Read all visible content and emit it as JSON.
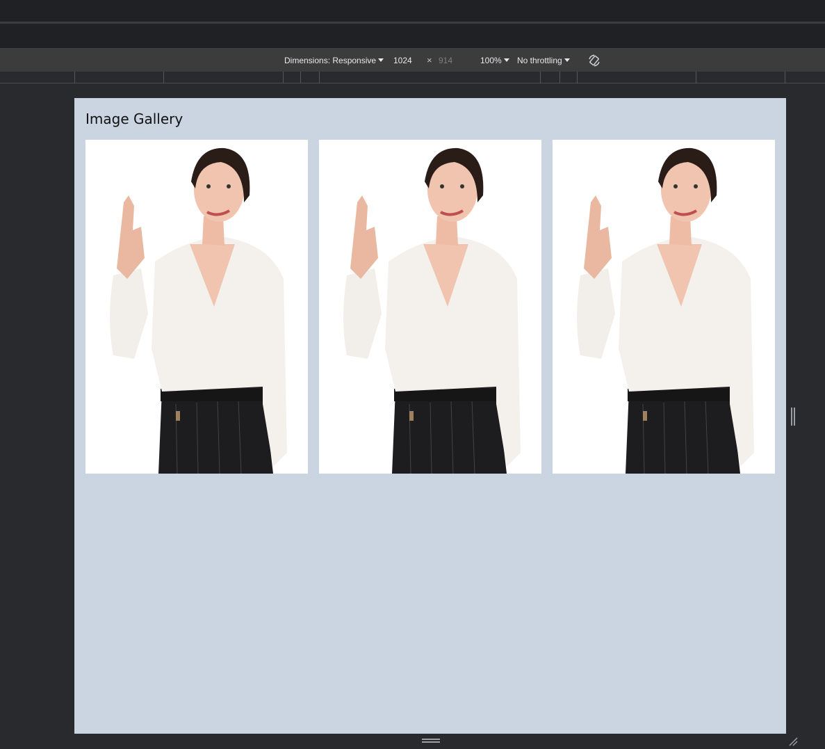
{
  "device_toolbar": {
    "dimensions_label": "Dimensions: Responsive",
    "width_value": "1024",
    "times_symbol": "×",
    "height_value": "914",
    "zoom_label": "100%",
    "throttling_label": "No throttling"
  },
  "page": {
    "title": "Image Gallery",
    "images": [
      {
        "alt": "Woman in white blouse pointing up"
      },
      {
        "alt": "Woman in white blouse pointing up"
      },
      {
        "alt": "Woman in white blouse pointing up"
      }
    ]
  },
  "colors": {
    "viewport_background": "#cbd5e1",
    "devtools_background": "#292a2d",
    "toolbar_background": "#3c3c3c"
  },
  "icons": {
    "rotate": "rotate-icon",
    "dimensions_dropdown": "chevron-down-icon",
    "zoom_dropdown": "chevron-down-icon",
    "throttling_dropdown": "chevron-down-icon",
    "side_resize": "resize-handle-icon",
    "bottom_resize": "resize-handle-icon",
    "corner_resize": "resize-corner-icon"
  }
}
